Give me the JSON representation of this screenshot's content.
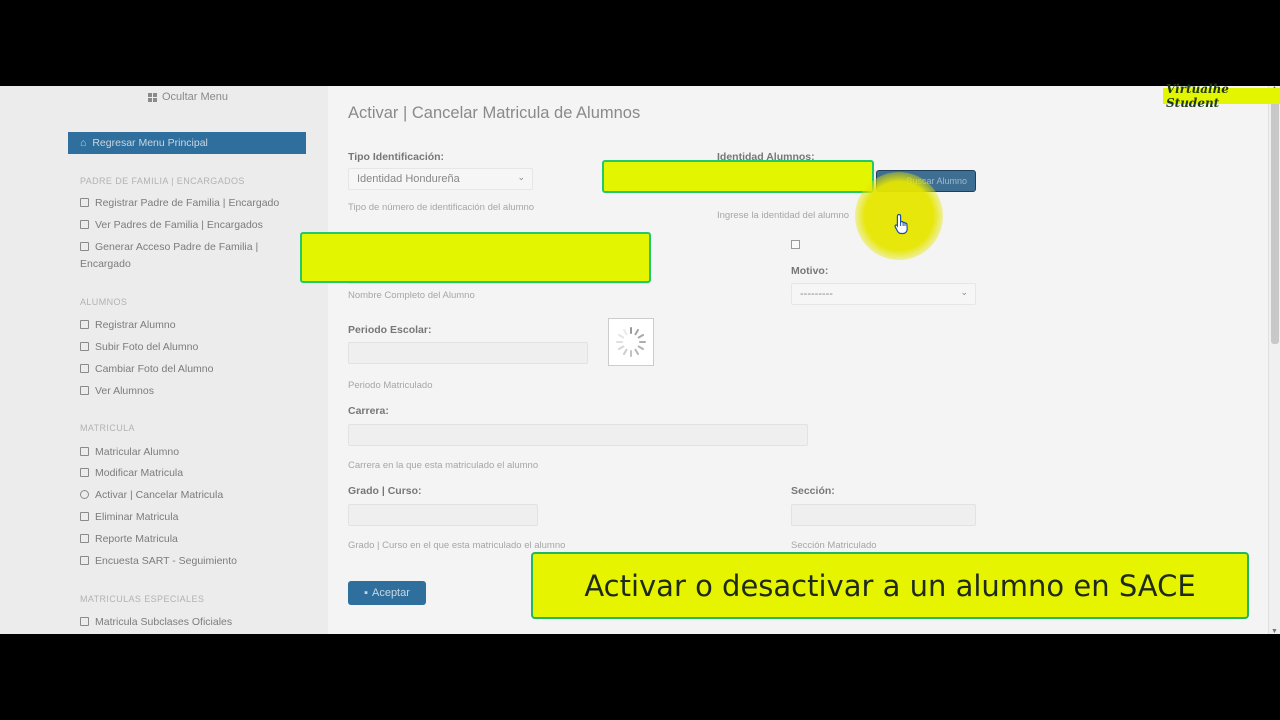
{
  "sidebar": {
    "hide_menu": "Ocultar Menu",
    "main_menu": "Regresar Menu Principal",
    "sections": [
      {
        "title": "PADRE DE FAMILIA | ENCARGADOS",
        "items": [
          "Registrar Padre de Familia | Encargado",
          "Ver Padres de Familia | Encargados",
          "Generar Acceso Padre de Familia | Encargado"
        ]
      },
      {
        "title": "ALUMNOS",
        "items": [
          "Registrar Alumno",
          "Subir Foto del Alumno",
          "Cambiar Foto del Alumno",
          "Ver Alumnos"
        ]
      },
      {
        "title": "MATRICULA",
        "items": [
          "Matricular Alumno",
          "Modificar Matricula",
          "Activar | Cancelar Matricula",
          "Eliminar Matricula",
          "Reporte Matricula",
          "Encuesta SART - Seguimiento"
        ]
      },
      {
        "title": "MATRICULAS ESPECIALES",
        "items": [
          "Matricula Subclases Oficiales"
        ]
      }
    ]
  },
  "form": {
    "title": "Activar | Cancelar Matricula de Alumnos",
    "tipo_label": "Tipo Identificación:",
    "tipo_value": "Identidad Hondureña",
    "tipo_hint": "Tipo de número de identificación del alumno",
    "identidad_label": "Identidad Alumnos:",
    "identidad_hint": "Ingrese la identidad del alumno",
    "nombre_hint": "Nombre Completo del Alumno",
    "motivo_label": "Motivo:",
    "motivo_value": "---------",
    "periodo_label": "Periodo Escolar:",
    "periodo_hint": "Periodo Matriculado",
    "carrera_label": "Carrera:",
    "carrera_hint": "Carrera en la que esta matriculado el alumno",
    "grado_label": "Grado | Curso:",
    "grado_hint": "Grado | Curso en el que esta matriculado el alumno",
    "seccion_label": "Sección:",
    "seccion_hint": "Sección Matriculado",
    "search_button": "Buscar Alumno",
    "accept_button": "Aceptar"
  },
  "overlay": {
    "caption": "Activar o desactivar a un alumno en SACE",
    "watermark": "Virtualhe Student"
  },
  "colors": {
    "highlight": "#e4f500",
    "button_blue": "#2f6f9e"
  }
}
